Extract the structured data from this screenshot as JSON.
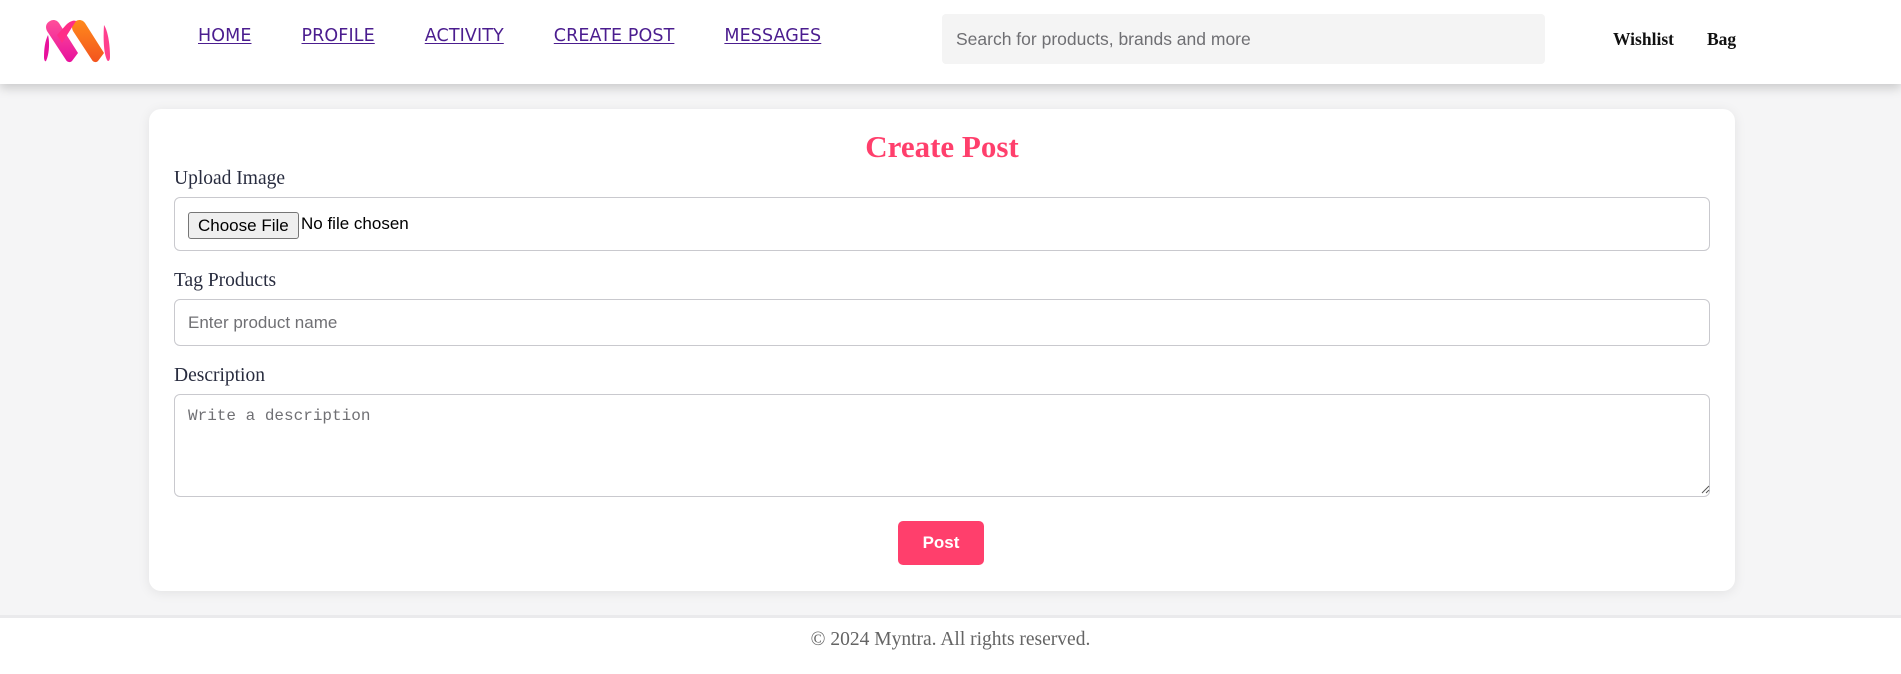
{
  "brand": {
    "logo_icon": "myntra-m-logo-icon",
    "colors": {
      "accent": "#ff3f6c",
      "logo_gradient_start": "#ff3f8e",
      "logo_gradient_end": "#f97417",
      "nav_link": "#4b1d8f"
    }
  },
  "nav": {
    "items": [
      {
        "label": "HOME"
      },
      {
        "label": "PROFILE"
      },
      {
        "label": "ACTIVITY"
      },
      {
        "label": "CREATE POST"
      },
      {
        "label": "MESSAGES"
      }
    ]
  },
  "search": {
    "placeholder": "Search for products, brands and more",
    "value": ""
  },
  "header_links": {
    "wishlist": "Wishlist",
    "bag": "Bag"
  },
  "create_post": {
    "title": "Create Post",
    "upload": {
      "label": "Upload Image",
      "button_label": "Choose File",
      "status": "No file chosen"
    },
    "tag_products": {
      "label": "Tag Products",
      "placeholder": "Enter product name",
      "value": ""
    },
    "description": {
      "label": "Description",
      "placeholder": "Write a description",
      "value": ""
    },
    "post_button": "Post"
  },
  "footer": {
    "text": "© 2024 Myntra. All rights reserved."
  }
}
